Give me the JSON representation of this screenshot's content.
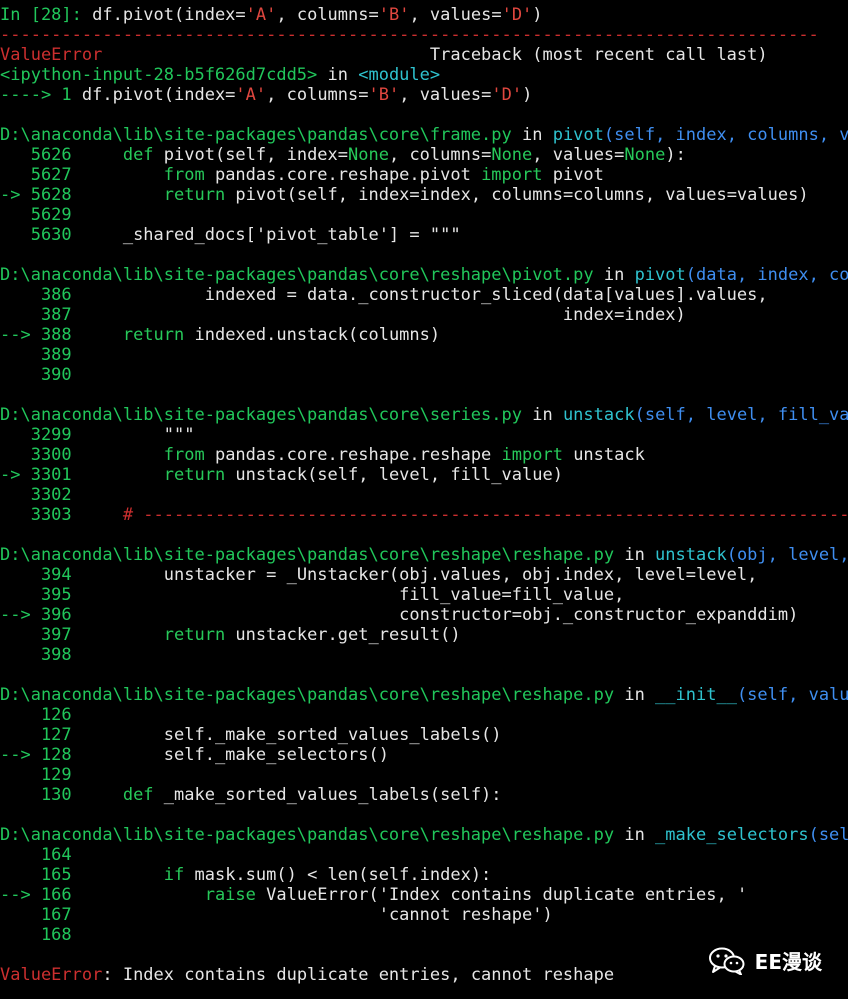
{
  "colors": {
    "background": "#000000",
    "default_text": "#e6e6e6",
    "prompt": "#21c75b",
    "error": "#e0473f",
    "keyword": "#27c95a",
    "path": "#27c95a",
    "function_def": "#3f8ef0",
    "string": "#d070d8"
  },
  "lines": [
    [
      {
        "t": "In [28]: ",
        "c": "g"
      },
      {
        "t": "df.pivot(index=",
        "c": "w"
      },
      {
        "t": "'A'",
        "c": "r"
      },
      {
        "t": ", columns=",
        "c": "w"
      },
      {
        "t": "'B'",
        "c": "r"
      },
      {
        "t": ", values=",
        "c": "w"
      },
      {
        "t": "'D'",
        "c": "r"
      },
      {
        "t": ")",
        "c": "w"
      }
    ],
    [
      {
        "t": "--------------------------------------------------------------------------------",
        "c": "rd"
      }
    ],
    [
      {
        "t": "ValueError",
        "c": "rd"
      },
      {
        "t": "                                Traceback (most recent call last)",
        "c": "w"
      }
    ],
    [
      {
        "t": "<ipython-input-28-b5f626d7cdd5>",
        "c": "g"
      },
      {
        "t": " in ",
        "c": "w"
      },
      {
        "t": "<module>",
        "c": "c"
      }
    ],
    [
      {
        "t": "----> 1 ",
        "c": "g"
      },
      {
        "t": "df.pivot(index=",
        "c": "w"
      },
      {
        "t": "'A'",
        "c": "r"
      },
      {
        "t": ", columns=",
        "c": "w"
      },
      {
        "t": "'B'",
        "c": "r"
      },
      {
        "t": ", values=",
        "c": "w"
      },
      {
        "t": "'D'",
        "c": "r"
      },
      {
        "t": ")",
        "c": "w"
      }
    ],
    [
      {
        "t": "",
        "c": "w"
      }
    ],
    [
      {
        "t": "D:\\anaconda\\lib\\site-packages\\pandas\\core\\frame.py",
        "c": "g"
      },
      {
        "t": " in ",
        "c": "w"
      },
      {
        "t": "pivot",
        "c": "c"
      },
      {
        "t": "(self, index, columns, values)",
        "c": "b"
      }
    ],
    [
      {
        "t": "   5626     ",
        "c": "g"
      },
      {
        "t": "def ",
        "c": "gl"
      },
      {
        "t": "pivot(self, index=",
        "c": "w"
      },
      {
        "t": "None",
        "c": "gl"
      },
      {
        "t": ", columns=",
        "c": "w"
      },
      {
        "t": "None",
        "c": "gl"
      },
      {
        "t": ", values=",
        "c": "w"
      },
      {
        "t": "None",
        "c": "gl"
      },
      {
        "t": "):",
        "c": "w"
      }
    ],
    [
      {
        "t": "   5627         ",
        "c": "g"
      },
      {
        "t": "from ",
        "c": "gl"
      },
      {
        "t": "pandas.core.reshape.pivot ",
        "c": "w"
      },
      {
        "t": "import ",
        "c": "gl"
      },
      {
        "t": "pivot",
        "c": "w"
      }
    ],
    [
      {
        "t": "-> 5628         ",
        "c": "g"
      },
      {
        "t": "return ",
        "c": "gl"
      },
      {
        "t": "pivot(self, index=index, columns=columns, values=values)",
        "c": "w"
      }
    ],
    [
      {
        "t": "   5629",
        "c": "g"
      }
    ],
    [
      {
        "t": "   5630     ",
        "c": "g"
      },
      {
        "t": "_shared_docs['pivot_table'] = \"\"\"",
        "c": "w"
      }
    ],
    [
      {
        "t": "",
        "c": "w"
      }
    ],
    [
      {
        "t": "D:\\anaconda\\lib\\site-packages\\pandas\\core\\reshape\\pivot.py",
        "c": "g"
      },
      {
        "t": " in ",
        "c": "w"
      },
      {
        "t": "pivot",
        "c": "c"
      },
      {
        "t": "(data, index, columns, values)",
        "c": "b"
      }
    ],
    [
      {
        "t": "    386             ",
        "c": "g"
      },
      {
        "t": "indexed = data._constructor_sliced(data[values].values,",
        "c": "w"
      }
    ],
    [
      {
        "t": "    387                                                ",
        "c": "g"
      },
      {
        "t": "index=index)",
        "c": "w"
      }
    ],
    [
      {
        "t": "--> 388     ",
        "c": "g"
      },
      {
        "t": "return ",
        "c": "gl"
      },
      {
        "t": "indexed.unstack(columns)",
        "c": "w"
      }
    ],
    [
      {
        "t": "    389",
        "c": "g"
      }
    ],
    [
      {
        "t": "    390",
        "c": "g"
      }
    ],
    [
      {
        "t": "",
        "c": "w"
      }
    ],
    [
      {
        "t": "D:\\anaconda\\lib\\site-packages\\pandas\\core\\series.py",
        "c": "g"
      },
      {
        "t": " in ",
        "c": "w"
      },
      {
        "t": "unstack",
        "c": "c"
      },
      {
        "t": "(self, level, fill_value)",
        "c": "b"
      }
    ],
    [
      {
        "t": "   3299         ",
        "c": "g"
      },
      {
        "t": "\"\"\"",
        "c": "w"
      }
    ],
    [
      {
        "t": "   3300         ",
        "c": "g"
      },
      {
        "t": "from ",
        "c": "gl"
      },
      {
        "t": "pandas.core.reshape.reshape ",
        "c": "w"
      },
      {
        "t": "import ",
        "c": "gl"
      },
      {
        "t": "unstack",
        "c": "w"
      }
    ],
    [
      {
        "t": "-> 3301         ",
        "c": "g"
      },
      {
        "t": "return ",
        "c": "gl"
      },
      {
        "t": "unstack(self, level, fill_value)",
        "c": "w"
      }
    ],
    [
      {
        "t": "   3302",
        "c": "g"
      }
    ],
    [
      {
        "t": "   3303     ",
        "c": "g"
      },
      {
        "t": "# ---------------------------------------------------------------------",
        "c": "rd"
      }
    ],
    [
      {
        "t": "",
        "c": "w"
      }
    ],
    [
      {
        "t": "D:\\anaconda\\lib\\site-packages\\pandas\\core\\reshape\\reshape.py",
        "c": "g"
      },
      {
        "t": " in ",
        "c": "w"
      },
      {
        "t": "unstack",
        "c": "c"
      },
      {
        "t": "(obj, level, fill_value)",
        "c": "b"
      }
    ],
    [
      {
        "t": "    394         ",
        "c": "g"
      },
      {
        "t": "unstacker = _Unstacker(obj.values, obj.index, level=level,",
        "c": "w"
      }
    ],
    [
      {
        "t": "    395                                ",
        "c": "g"
      },
      {
        "t": "fill_value=fill_value,",
        "c": "w"
      }
    ],
    [
      {
        "t": "--> 396                                ",
        "c": "g"
      },
      {
        "t": "constructor=obj._constructor_expanddim)",
        "c": "w"
      }
    ],
    [
      {
        "t": "    397         ",
        "c": "g"
      },
      {
        "t": "return ",
        "c": "gl"
      },
      {
        "t": "unstacker.get_result()",
        "c": "w"
      }
    ],
    [
      {
        "t": "    398",
        "c": "g"
      }
    ],
    [
      {
        "t": "",
        "c": "w"
      }
    ],
    [
      {
        "t": "D:\\anaconda\\lib\\site-packages\\pandas\\core\\reshape\\reshape.py",
        "c": "g"
      },
      {
        "t": " in ",
        "c": "w"
      },
      {
        "t": "__init__",
        "c": "c"
      },
      {
        "t": "(self, values, index, level, value_columns, fill_value, constructor)",
        "c": "b"
      }
    ],
    [
      {
        "t": "    126",
        "c": "g"
      }
    ],
    [
      {
        "t": "    127         ",
        "c": "g"
      },
      {
        "t": "self._make_sorted_values_labels()",
        "c": "w"
      }
    ],
    [
      {
        "t": "--> 128         ",
        "c": "g"
      },
      {
        "t": "self._make_selectors()",
        "c": "w"
      }
    ],
    [
      {
        "t": "    129",
        "c": "g"
      }
    ],
    [
      {
        "t": "    130     ",
        "c": "g"
      },
      {
        "t": "def ",
        "c": "gl"
      },
      {
        "t": "_make_sorted_values_labels(self):",
        "c": "w"
      }
    ],
    [
      {
        "t": "",
        "c": "w"
      }
    ],
    [
      {
        "t": "D:\\anaconda\\lib\\site-packages\\pandas\\core\\reshape\\reshape.py",
        "c": "g"
      },
      {
        "t": " in ",
        "c": "w"
      },
      {
        "t": "_make_selectors",
        "c": "c"
      },
      {
        "t": "(self)",
        "c": "b"
      }
    ],
    [
      {
        "t": "    164",
        "c": "g"
      }
    ],
    [
      {
        "t": "    165         ",
        "c": "g"
      },
      {
        "t": "if ",
        "c": "gl"
      },
      {
        "t": "mask.sum() < len(self.index):",
        "c": "w"
      }
    ],
    [
      {
        "t": "--> 166             ",
        "c": "g"
      },
      {
        "t": "raise ",
        "c": "gl"
      },
      {
        "t": "ValueError(",
        "c": "w"
      },
      {
        "t": "'Index contains duplicate entries, '",
        "c": "w"
      }
    ],
    [
      {
        "t": "    167                              ",
        "c": "g"
      },
      {
        "t": "'cannot reshape')",
        "c": "w"
      }
    ],
    [
      {
        "t": "    168",
        "c": "g"
      }
    ],
    [
      {
        "t": "",
        "c": "w"
      }
    ],
    [
      {
        "t": "ValueError",
        "c": "rd"
      },
      {
        "t": ": Index contains duplicate entries, cannot reshape",
        "c": "w"
      }
    ]
  ],
  "watermark": {
    "text": "EE漫谈",
    "icon": "wechat-icon"
  }
}
